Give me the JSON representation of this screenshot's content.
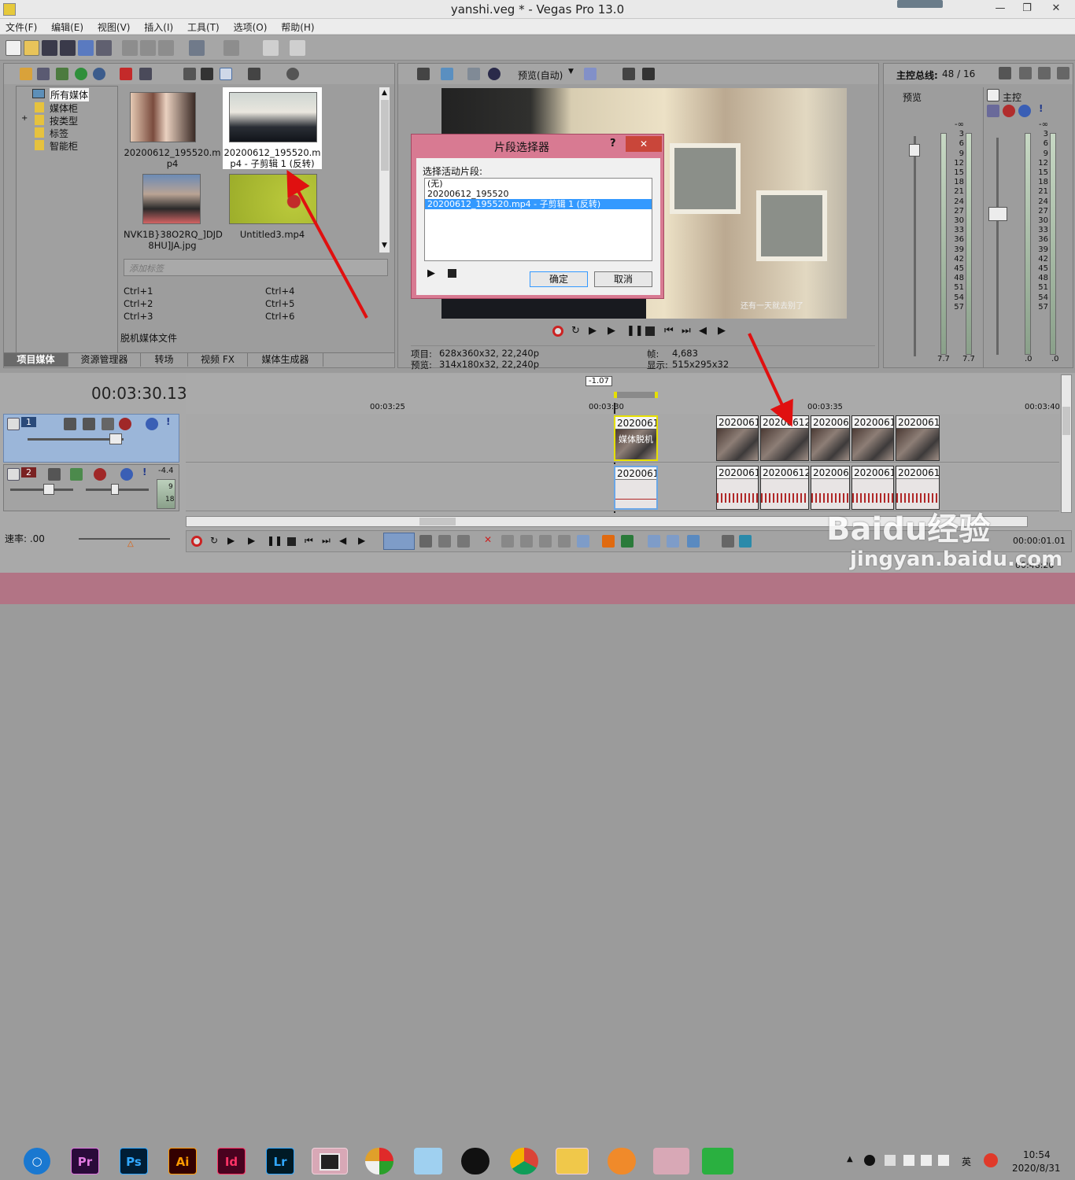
{
  "window": {
    "title": "yanshi.veg * - Vegas Pro 13.0",
    "btn_min": "—",
    "btn_max": "❐",
    "btn_close": "✕"
  },
  "menu": [
    "文件(F)",
    "编辑(E)",
    "视图(V)",
    "插入(I)",
    "工具(T)",
    "选项(O)",
    "帮助(H)"
  ],
  "media_tree": {
    "items": [
      "所有媒体",
      "媒体柜",
      "按类型",
      "标签",
      "智能柜"
    ],
    "expand_sign": "+"
  },
  "media_files": [
    {
      "name_line1": "20200612_195520.m",
      "name_line2": "p4"
    },
    {
      "name_line1": "20200612_195520.m",
      "name_line2": "p4 - 子剪辑 1 (反转)"
    },
    {
      "name_line1": "NVK1B}38O2RQ_]DJD",
      "name_line2": "8HU]JA.jpg"
    },
    {
      "name_line1": "Untitled3.mp4",
      "name_line2": ""
    }
  ],
  "tag_input_placeholder": "添加标签",
  "shortcuts": [
    "Ctrl+1",
    "Ctrl+4",
    "Ctrl+2",
    "Ctrl+5",
    "Ctrl+3",
    "Ctrl+6"
  ],
  "offline_label": "脱机媒体文件",
  "bottom_tabs": [
    "项目媒体",
    "资源管理器",
    "转场",
    "视频 FX",
    "媒体生成器"
  ],
  "preview": {
    "mode_label": "预览(自动)",
    "project_label": "项目:",
    "project_value": "628x360x32, 22,240p",
    "preview_label": "预览:",
    "preview_value": "314x180x32, 22,240p",
    "frame_label": "帧:",
    "frame_value": "4,683",
    "display_label": "显示:",
    "display_value": "515x295x32",
    "overlay_text": "还有一天就去别了"
  },
  "dialog": {
    "title": "片段选择器",
    "help": "?",
    "close": "✕",
    "prompt": "选择活动片段:",
    "options": [
      "(无)",
      "20200612_195520",
      "20200612_195520.mp4 - 子剪辑 1 (反转)"
    ],
    "selected_index": 2,
    "ok": "确定",
    "cancel": "取消"
  },
  "mixer": {
    "title": "主控总线:",
    "value": "48 / 16",
    "preview_label": "预览",
    "master_label": "主控",
    "scale": [
      "-∞",
      "3",
      "6",
      "9",
      "12",
      "15",
      "18",
      "21",
      "24",
      "27",
      "30",
      "33",
      "36",
      "39",
      "42",
      "45",
      "48",
      "51",
      "54",
      "57"
    ],
    "preview_peaks": [
      "7.7",
      "7.7"
    ],
    "master_peaks": [
      ".0",
      ".0"
    ]
  },
  "timeline": {
    "timecode": "00:03:30.13",
    "rate_badge": "-1.07",
    "ruler": [
      "00:03:25",
      "00:03:30",
      "00:03:35",
      "00:03:40"
    ],
    "track1_num": "1",
    "track2_num": "2",
    "track2_db": "-4.4",
    "track2_meter": [
      "9",
      "18"
    ],
    "clip_label": "20200612",
    "clip_label_short": "2020061",
    "clip_sub": "媒体脱机",
    "rate_label": "速率: .00",
    "end_time": "00:00:01.01",
    "bottom_time": "00:48:20"
  },
  "taskbar": {
    "apps": [
      "Pr",
      "Ps",
      "Ai",
      "Id",
      "Lr"
    ],
    "lang": "英",
    "time": "10:54",
    "date": "2020/8/31"
  },
  "watermark": {
    "brand": "Baidu经验",
    "url": "jingyan.baidu.com"
  },
  "colors": {
    "accent": "#3399ff",
    "dialog": "#d87a92",
    "arrow": "#e01010"
  }
}
